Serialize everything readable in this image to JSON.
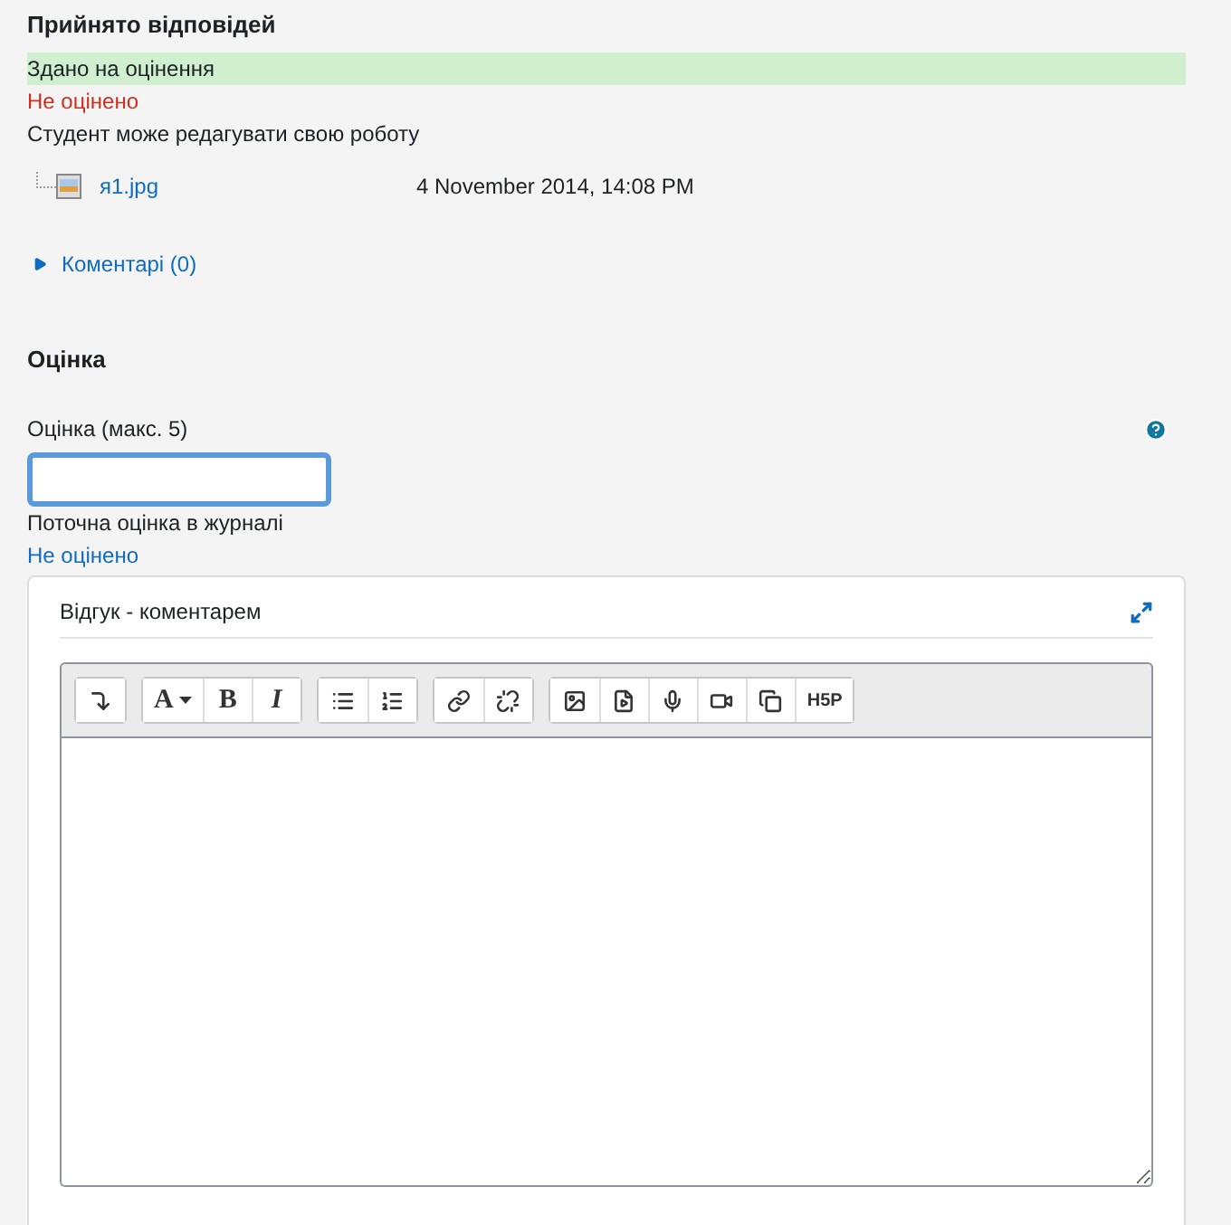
{
  "submission": {
    "heading": "Прийнято відповідей",
    "status_rows": [
      {
        "text": "Здано на оцінення",
        "kind": "success"
      },
      {
        "text": "Не оцінено",
        "kind": "danger"
      },
      {
        "text": "Студент може редагувати свою роботу",
        "kind": "plain"
      }
    ],
    "files": [
      {
        "name": "я1.jpg",
        "date": "4 November 2014, 14:08 PM"
      }
    ],
    "comments_link": "Коментарі (0)",
    "comments_expanded": false
  },
  "grade": {
    "heading": "Оцінка",
    "field_label": "Оцінка (макс. 5)",
    "current_label": "Поточна оцінка в журналі",
    "current_value": "Не оцінено"
  },
  "feedback": {
    "title": "Відгук - коментарем",
    "toolbar": [
      [
        {
          "kind": "collapse"
        }
      ],
      [
        {
          "kind": "font",
          "label": "A"
        },
        {
          "kind": "bold",
          "label": "B"
        },
        {
          "kind": "italic",
          "label": "I"
        }
      ],
      [
        {
          "kind": "bullets"
        },
        {
          "kind": "numbers"
        }
      ],
      [
        {
          "kind": "link"
        },
        {
          "kind": "unlink"
        }
      ],
      [
        {
          "kind": "image"
        },
        {
          "kind": "media"
        },
        {
          "kind": "mic"
        },
        {
          "kind": "video"
        },
        {
          "kind": "copy"
        },
        {
          "kind": "h5p",
          "label": "H5P"
        }
      ]
    ]
  }
}
